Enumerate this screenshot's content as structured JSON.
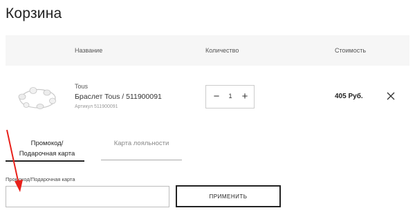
{
  "page": {
    "title": "Корзина"
  },
  "table": {
    "headers": {
      "name": "Название",
      "quantity": "Количество",
      "price": "Стоимость"
    }
  },
  "item": {
    "brand": "Tous",
    "name": "Браслет Tous / 511900091",
    "article": "Артикул 511900091",
    "quantity": "1",
    "price": "405 Руб.",
    "image_icon": "bracelet-image",
    "remove_icon": "close-icon"
  },
  "stepper": {
    "minus": "−",
    "plus": "+"
  },
  "tabs": [
    {
      "label": "Промокод/ Подарочная карта",
      "active": true
    },
    {
      "label": "Карта лояльности",
      "active": false
    }
  ],
  "promo_form": {
    "label": "Промокод/Подарочная карта",
    "value": "",
    "placeholder": "",
    "apply_label": "ПРИМЕНИТЬ"
  },
  "colors": {
    "header_bg": "#f6f6f6",
    "annotation_arrow": "#e8201a",
    "text": "#222222"
  }
}
